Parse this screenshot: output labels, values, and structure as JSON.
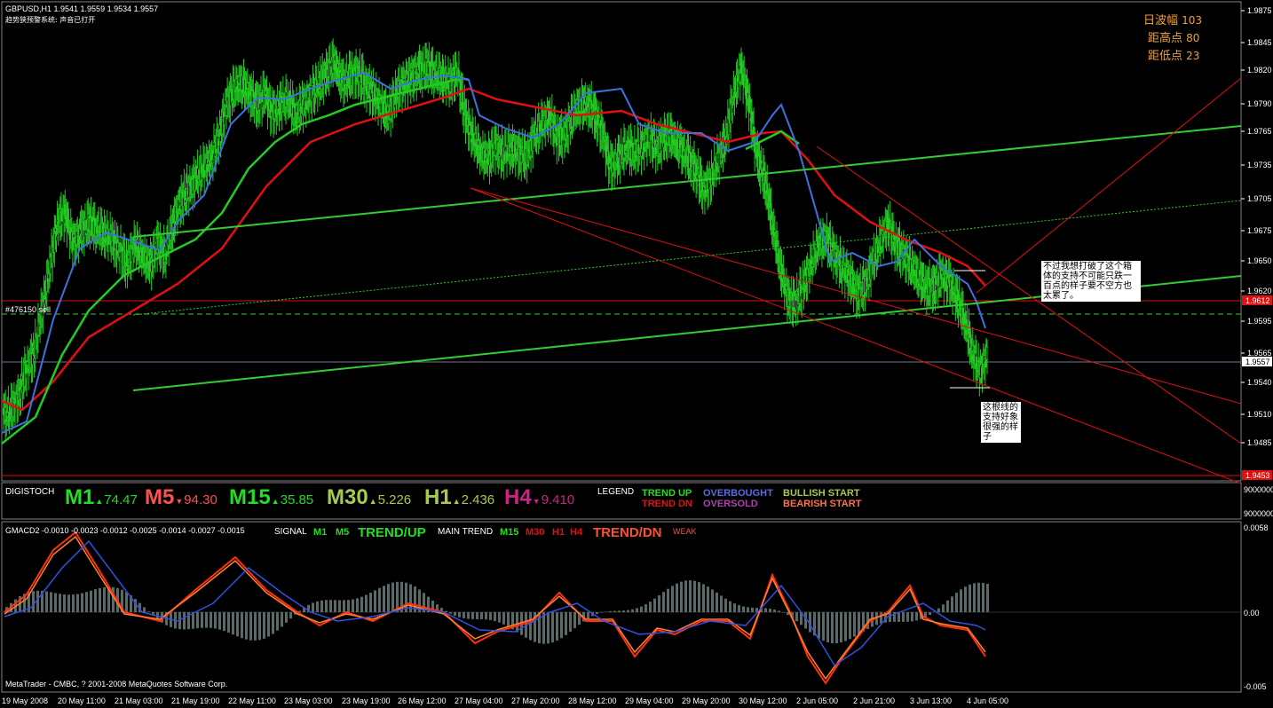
{
  "window": {
    "symbol_line": "GBPUSD,H1  1.9541 1.9559 1.9534 1.9557",
    "subtitle": "趋势狭预警系统: 声音已打开",
    "copyright": "MetaTrader - CMBC, ? 2001-2008 MetaQuotes Software Corp."
  },
  "stats": [
    {
      "label": "日波幅",
      "value": "103"
    },
    {
      "label": "距高点",
      "value": "80"
    },
    {
      "label": "距低点",
      "value": "23"
    }
  ],
  "annotations": {
    "box1": "不过我想打破了这个箱体的支持不可能只跌一百点的样子要不空方也太累了。",
    "box2": "这根线的支持好象很强的样子",
    "order_label": "#476150 sell"
  },
  "price_axis": {
    "ticks": [
      "1.9875",
      "1.9845",
      "1.9820",
      "1.9790",
      "1.9765",
      "1.9735",
      "1.9705",
      "1.9675",
      "1.9650",
      "1.9620",
      "1.9595",
      "1.9565",
      "1.9540",
      "1.9510",
      "1.9485"
    ],
    "sell_tag": "1.9612",
    "current_tag": "1.9557",
    "bottom_tag": "1.9453"
  },
  "time_axis": [
    "19 May 2008",
    "20 May 11:00",
    "21 May 03:00",
    "21 May 19:00",
    "22 May 11:00",
    "23 May 03:00",
    "23 May 19:00",
    "26 May 12:00",
    "27 May 04:00",
    "27 May 20:00",
    "28 May 12:00",
    "29 May 04:00",
    "29 May 20:00",
    "30 May 12:00",
    "2 Jun 05:00",
    "2 Jun 21:00",
    "3 Jun 13:00",
    "4 Jun 05:00"
  ],
  "digistoch": {
    "title": "DIGISTOCH",
    "timeframes": [
      {
        "tf": "M1",
        "dir": "up",
        "value": "74.47",
        "color": "#22dd22",
        "vcolor": "#22dd22"
      },
      {
        "tf": "M5",
        "dir": "dn",
        "value": "94.30",
        "color": "#ff5050",
        "vcolor": "#ff5050"
      },
      {
        "tf": "M15",
        "dir": "up",
        "value": "35.85",
        "color": "#22dd22",
        "vcolor": "#22dd22"
      },
      {
        "tf": "M30",
        "dir": "up",
        "value": "5.226",
        "color": "#a8c850",
        "vcolor": "#a8c850"
      },
      {
        "tf": "H1",
        "dir": "up",
        "value": "2.436",
        "color": "#a8c850",
        "vcolor": "#a8c850"
      },
      {
        "tf": "H4",
        "dir": "dn",
        "value": "9.410",
        "color": "#cc2288",
        "vcolor": "#cc2288"
      }
    ],
    "legend_title": "LEGEND",
    "legend": {
      "trend_up": "TREND UP",
      "trend_dn": "TREND DN",
      "overbought": "OVERBOUGHT",
      "oversold": "OVERSOLD",
      "bullish": "BULLISH START",
      "bearish": "BEARISH START"
    },
    "axis_top": "9000000",
    "axis_bottom": "9000000"
  },
  "gmacd": {
    "title": "GMACD2 -0.0010 -0.0023 -0.0012 -0.0025 -0.0014 -0.0027 -0.0015",
    "signal": "SIGNAL",
    "m1": "M1",
    "m5": "M5",
    "trend_up": "TREND/UP",
    "main_trend": "MAIN TREND",
    "m15": "M15",
    "m30": "M30",
    "h1": "H1",
    "h4": "H4",
    "trend_dn": "TREND/DN",
    "weak": "WEAK",
    "axis": [
      "0.0058",
      "0.00",
      "-0.005"
    ]
  },
  "colors": {
    "bull": "#22cc22",
    "ma_red": "#e01010",
    "ma_blue": "#4060e0",
    "ma_green": "#22cc22",
    "trend": "#33cc33",
    "support": "#e01010"
  },
  "chart_data": {
    "type": "candlestick",
    "symbol": "GBPUSD",
    "timeframe": "H1",
    "ylim": [
      1.944,
      1.9885
    ],
    "close_series": [
      1.95,
      1.9505,
      1.952,
      1.9545,
      1.956,
      1.96,
      1.964,
      1.968,
      1.969,
      1.966,
      1.967,
      1.968,
      1.9675,
      1.967,
      1.9665,
      1.9655,
      1.964,
      1.966,
      1.965,
      1.964,
      1.966,
      1.965,
      1.968,
      1.97,
      1.971,
      1.972,
      1.973,
      1.974,
      1.976,
      1.979,
      1.9805,
      1.981,
      1.98,
      1.979,
      1.98,
      1.978,
      1.979,
      1.9795,
      1.978,
      1.979,
      1.98,
      1.981,
      1.982,
      1.983,
      1.981,
      1.9815,
      1.982,
      1.981,
      1.98,
      1.979,
      1.978,
      1.98,
      1.981,
      1.9815,
      1.982,
      1.9825,
      1.982,
      1.9815,
      1.981,
      1.982,
      1.978,
      1.976,
      1.9745,
      1.974,
      1.975,
      1.9745,
      1.975,
      1.9745,
      1.974,
      1.976,
      1.977,
      1.978,
      1.976,
      1.976,
      1.978,
      1.979,
      1.979,
      1.978,
      1.976,
      1.973,
      1.974,
      1.975,
      1.9745,
      1.975,
      1.976,
      1.975,
      1.976,
      1.976,
      1.975,
      1.974,
      1.973,
      1.971,
      1.972,
      1.974,
      1.976,
      1.98,
      1.9825,
      1.979,
      1.974,
      1.972,
      1.968,
      1.964,
      1.961,
      1.9605,
      1.962,
      1.964,
      1.966,
      1.9665,
      1.965,
      1.964,
      1.963,
      1.9615,
      1.962,
      1.964,
      1.966,
      1.968,
      1.966,
      1.965,
      1.964,
      1.963,
      1.962,
      1.962,
      1.963,
      1.9625,
      1.961,
      1.959,
      1.956,
      1.954,
      1.9557
    ]
  }
}
